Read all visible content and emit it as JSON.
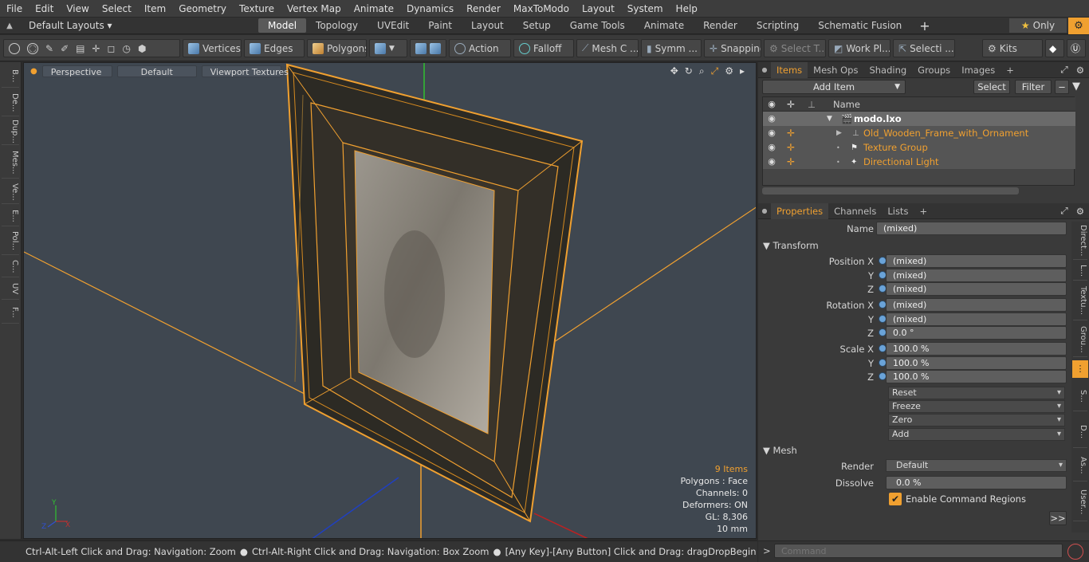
{
  "menu": [
    "File",
    "Edit",
    "View",
    "Select",
    "Item",
    "Geometry",
    "Texture",
    "Vertex Map",
    "Animate",
    "Dynamics",
    "Render",
    "MaxToModo",
    "Layout",
    "System",
    "Help"
  ],
  "layout": {
    "preset": "Default Layouts ▾",
    "tabs": [
      "Model",
      "Topology",
      "UVEdit",
      "Paint",
      "Layout",
      "Setup",
      "Game Tools",
      "Animate",
      "Render",
      "Scripting",
      "Schematic Fusion"
    ],
    "active_tab": "Model",
    "add": "+",
    "only_label": "Only"
  },
  "toolbar": {
    "vertices": "Vertices",
    "edges": "Edges",
    "polygons": "Polygons",
    "action": "Action",
    "falloff": "Falloff",
    "mesh": "Mesh C ...",
    "symmetry": "Symm ...",
    "snapping": "Snapping",
    "select_t": "Select T...",
    "work_plane": "Work Pl...",
    "selection": "Selecti ...",
    "kits": "Kits"
  },
  "left_strip": [
    "B...",
    "De...",
    "Dup...",
    "Mes...",
    "Ve...",
    "E...",
    "Pol...",
    "C...",
    "UV",
    "F..."
  ],
  "viewport": {
    "view": "Perspective",
    "shading": "Default",
    "textures": "Viewport Textures",
    "info": {
      "items": "9 Items",
      "polygons": "Polygons : Face",
      "channels": "Channels: 0",
      "deformers": "Deformers: ON",
      "gl": "GL: 8,306",
      "scale": "10 mm"
    }
  },
  "status": {
    "hint1": "Ctrl-Alt-Left Click and Drag: Navigation: Zoom",
    "hint2": "Ctrl-Alt-Right Click and Drag: Navigation: Box Zoom",
    "hint3": "[Any Key]-[Any Button] Click and Drag: dragDropBegin"
  },
  "items_panel": {
    "tabs": [
      "Items",
      "Mesh Ops",
      "Shading",
      "Groups",
      "Images"
    ],
    "active_tab": "Items",
    "add_item": "Add Item",
    "select": "Select",
    "filter": "Filter",
    "column_name": "Name",
    "rows": [
      {
        "name": "modo.lxo",
        "level": 0
      },
      {
        "name": "Old_Wooden_Frame_with_Ornament",
        "level": 1
      },
      {
        "name": "Texture Group",
        "level": 1
      },
      {
        "name": "Directional Light",
        "level": 1
      }
    ]
  },
  "properties": {
    "tabs": [
      "Properties",
      "Channels",
      "Lists"
    ],
    "active_tab": "Properties",
    "name_label": "Name",
    "name_value": "(mixed)",
    "transform_header": "Transform",
    "position_x_label": "Position X",
    "position_x": "(mixed)",
    "position_y": "(mixed)",
    "position_z": "(mixed)",
    "rotation_x_label": "Rotation X",
    "rotation_x": "(mixed)",
    "rotation_y": "(mixed)",
    "rotation_z": "0.0 °",
    "scale_x_label": "Scale X",
    "scale_x": "100.0 %",
    "scale_y": "100.0 %",
    "scale_z": "100.0 %",
    "y_label": "Y",
    "z_label": "Z",
    "reset": "Reset",
    "freeze": "Freeze",
    "zero": "Zero",
    "add": "Add",
    "mesh_header": "Mesh",
    "render_label": "Render",
    "render_value": "Default",
    "dissolve_label": "Dissolve",
    "dissolve_value": "0.0 %",
    "enable_regions": "Enable Command Regions",
    "more": ">>"
  },
  "right_strip": [
    "Direct...",
    "L...",
    "Textu...",
    "Grou...",
    "S...",
    "D...",
    "As...",
    "User..."
  ],
  "command": {
    "placeholder": "Command"
  },
  "colors": {
    "accent": "#f0a030",
    "panel": "#3a3a3a",
    "viewport": "#3f4750"
  }
}
